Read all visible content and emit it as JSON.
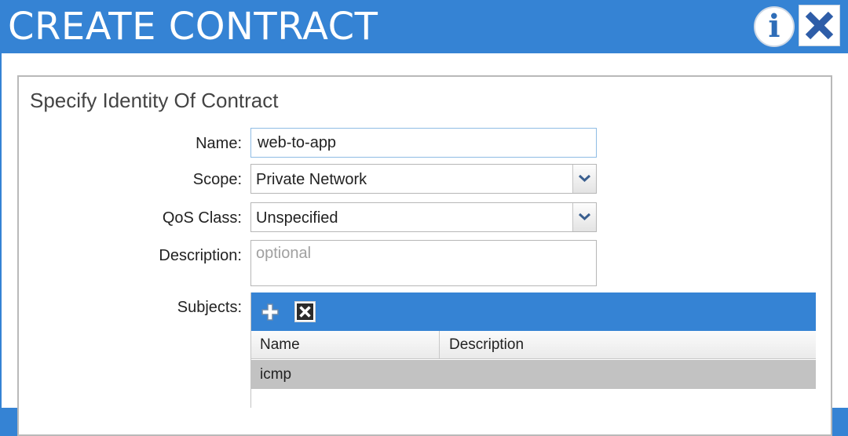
{
  "window": {
    "title": "CREATE CONTRACT",
    "info_icon": "info-icon",
    "close_icon": "close-icon",
    "accent_color": "#3583d4"
  },
  "form": {
    "section_title": "Specify Identity Of Contract",
    "name": {
      "label": "Name:",
      "value": "web-to-app"
    },
    "scope": {
      "label": "Scope:",
      "value": "Private Network"
    },
    "qos": {
      "label": "QoS Class:",
      "value": "Unspecified"
    },
    "description": {
      "label": "Description:",
      "placeholder": "optional"
    },
    "subjects": {
      "label": "Subjects:",
      "toolbar": {
        "add_icon": "add-icon",
        "delete_icon": "delete-icon"
      },
      "columns": [
        "Name",
        "Description"
      ],
      "rows": [
        {
          "name": "icmp",
          "description": ""
        }
      ]
    }
  }
}
